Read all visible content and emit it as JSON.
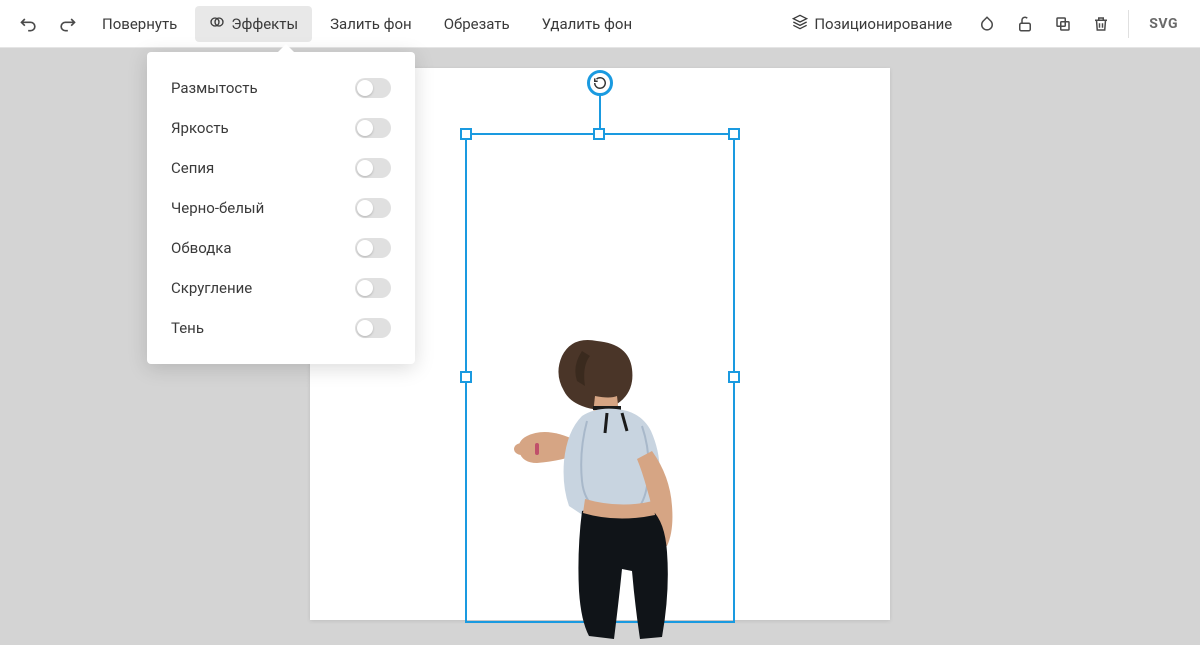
{
  "toolbar": {
    "rotate": "Повернуть",
    "effects": "Эффекты",
    "fill_bg": "Залить фон",
    "crop": "Обрезать",
    "remove_bg": "Удалить фон",
    "positioning": "Позиционирование",
    "format": "SVG"
  },
  "effects_panel": {
    "items": [
      {
        "label": "Размытость",
        "on": false
      },
      {
        "label": "Яркость",
        "on": false
      },
      {
        "label": "Сепия",
        "on": false
      },
      {
        "label": "Черно-белый",
        "on": false
      },
      {
        "label": "Обводка",
        "on": false
      },
      {
        "label": "Скругление",
        "on": false
      },
      {
        "label": "Тень",
        "on": false
      }
    ]
  },
  "colors": {
    "selection": "#1a9ae0",
    "toolbar_text": "#3a3a3a",
    "canvas_bg": "#d4d4d4"
  }
}
